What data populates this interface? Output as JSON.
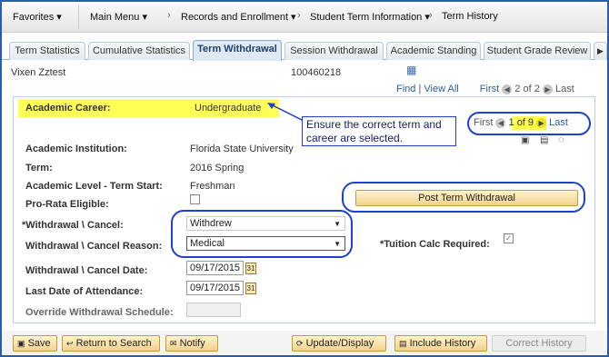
{
  "nav": {
    "favorites": "Favorites ▾",
    "main_menu": "Main Menu ▾",
    "records": "Records and Enrollment ▾",
    "student_term_info": "Student Term Information ▾",
    "term_history": "Term History"
  },
  "tabs": [
    "Term Statistics",
    "Cumulative Statistics",
    "Term Withdrawal",
    "Session Withdrawal",
    "Academic Standing",
    "Student Grade Review"
  ],
  "student": {
    "name": "Vixen Zztest",
    "id": "100460218"
  },
  "pager_top": {
    "find": "Find",
    "view_all": "View All",
    "first": "First",
    "count": "2 of 2",
    "last": "Last"
  },
  "pager_inner": {
    "first": "First",
    "count": "1 of 9",
    "last": "Last"
  },
  "academic_career": {
    "label": "Academic Career:",
    "value": "Undergraduate"
  },
  "callout": "Ensure the correct term and career are selected.",
  "fields": {
    "institution_label": "Academic Institution:",
    "institution_value": "Florida State University",
    "term_label": "Term:",
    "term_value": "2016 Spring",
    "level_label": "Academic Level - Term Start:",
    "level_value": "Freshman",
    "prorata_label": "Pro-Rata Eligible:",
    "withdrawal_label": "*Withdrawal \\ Cancel:",
    "withdrawal_value": "Withdrew",
    "reason_label": "Withdrawal \\ Cancel Reason:",
    "reason_value": "Medical",
    "tuition_label": "*Tuition Calc Required:",
    "date_label": "Withdrawal \\ Cancel Date:",
    "date_value": "09/17/2015",
    "last_attend_label": "Last Date of Attendance:",
    "last_attend_value": "09/17/2015",
    "override_label": "Override Withdrawal Schedule:"
  },
  "post_button": "Post Term Withdrawal",
  "footer": {
    "save": "Save",
    "return": "Return to Search",
    "notify": "Notify",
    "update": "Update/Display",
    "include": "Include History",
    "correct": "Correct History"
  },
  "colors": {
    "highlight": "#ffff55",
    "annotation": "#1f3fcf",
    "accent": "#2b5aa0"
  }
}
